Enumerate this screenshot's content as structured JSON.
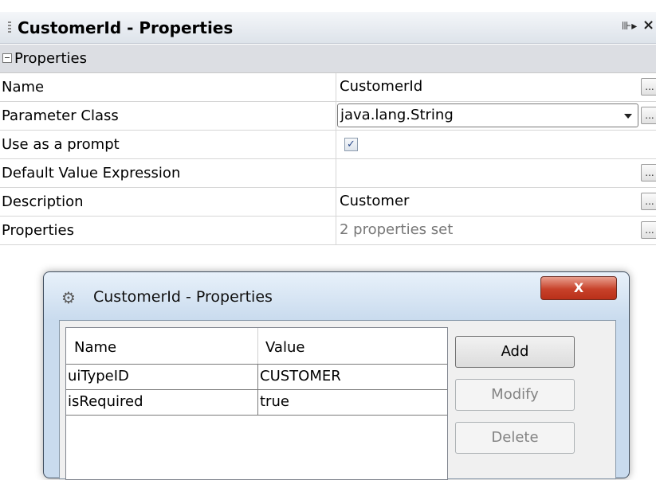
{
  "panel": {
    "title": "CustomerId - Properties",
    "pin_label": "⊪▸",
    "close_label": "×"
  },
  "section": {
    "label": "Properties"
  },
  "rows": [
    {
      "label": "Name",
      "value": "CustomerId"
    },
    {
      "label": "Parameter Class",
      "value": "java.lang.String"
    },
    {
      "label": "Use as a prompt",
      "checked": true
    },
    {
      "label": "Default Value Expression",
      "value": ""
    },
    {
      "label": "Description",
      "value": "Customer"
    },
    {
      "label": "Properties",
      "value": "2 properties set"
    }
  ],
  "ellipsis": "...",
  "dialog": {
    "title": "CustomerId - Properties",
    "close_label": "X",
    "columns": [
      "Name",
      "Value"
    ],
    "table_rows": [
      {
        "name": "uiTypeID",
        "value": "CUSTOMER"
      },
      {
        "name": "isRequired",
        "value": "true"
      }
    ],
    "buttons": {
      "add": "Add",
      "modify": "Modify",
      "delete": "Delete"
    }
  }
}
